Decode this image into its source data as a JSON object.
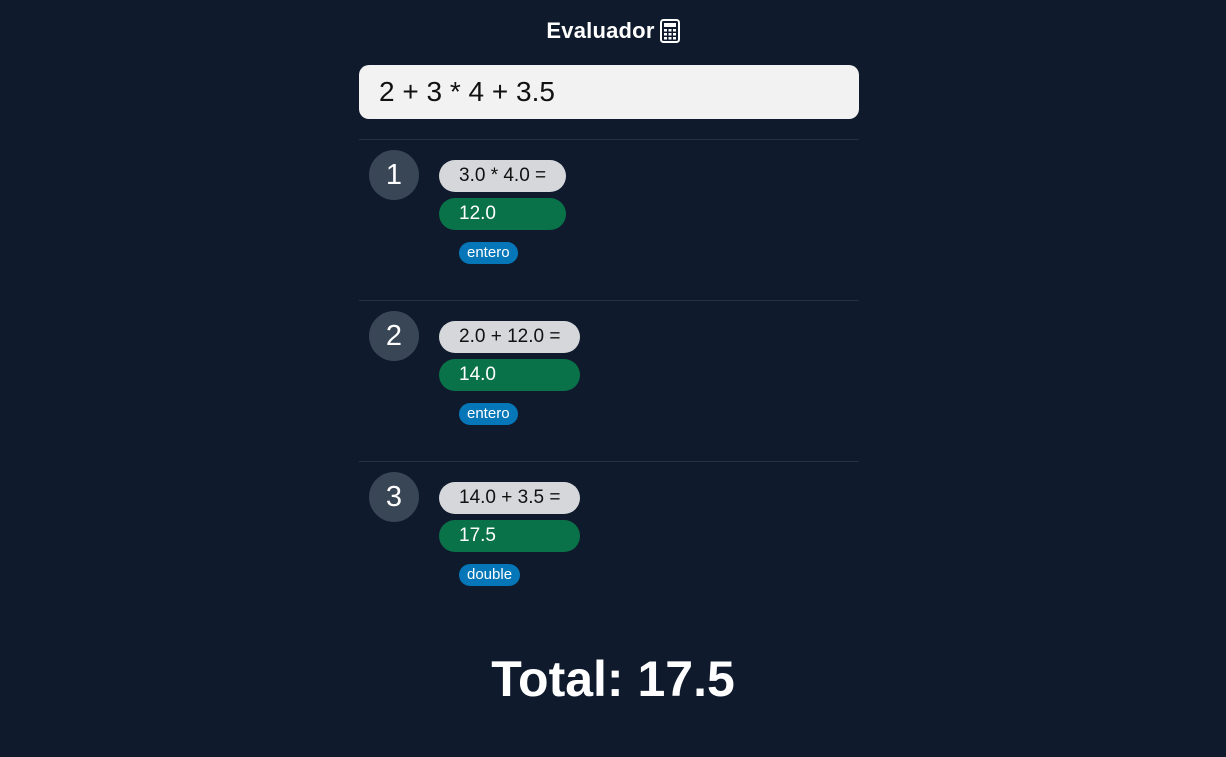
{
  "header": {
    "title": "Evaluador",
    "icon": "calculator-icon"
  },
  "input": {
    "value": "2 + 3 * 4 + 3.5"
  },
  "steps": [
    {
      "number": "1",
      "operation": "3.0 * 4.0 =",
      "result": "12.0",
      "type": "entero"
    },
    {
      "number": "2",
      "operation": "2.0 + 12.0 =",
      "result": "14.0",
      "type": "entero"
    },
    {
      "number": "3",
      "operation": "14.0 + 3.5 =",
      "result": "17.5",
      "type": "double"
    }
  ],
  "total": {
    "text": "Total: 17.5"
  },
  "colors": {
    "background": "#0f1b2d",
    "step_number_bg": "#384656",
    "operation_bg": "#d5d7da",
    "result_bg": "#0a7248",
    "type_badge_bg": "#0577b8"
  }
}
